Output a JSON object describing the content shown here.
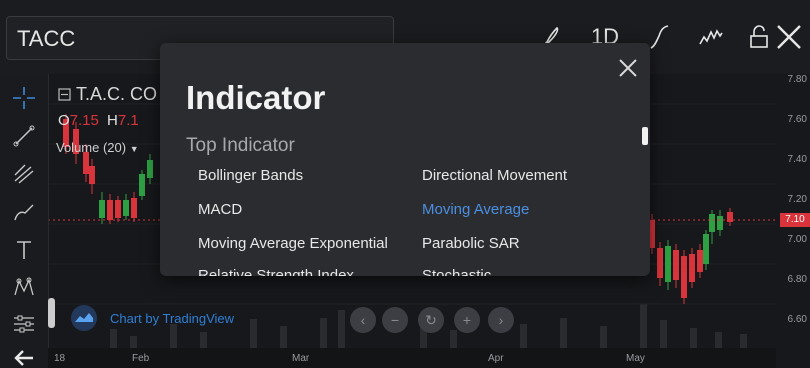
{
  "header": {
    "symbol": "TACC",
    "interval": "1D"
  },
  "legend": {
    "name": "T.A.C. CO",
    "open_label": "O",
    "open_value": "7.15",
    "high_label": "H",
    "high_value": "7.1",
    "volume_label": "Volume (20)"
  },
  "price_axis": [
    "7.80",
    "7.60",
    "7.40",
    "7.20",
    "7.10",
    "7.00",
    "6.80",
    "6.60"
  ],
  "time_axis": [
    "18",
    "Feb",
    "Mar",
    "Apr",
    "May"
  ],
  "watermark": "Chart by TradingView",
  "modal": {
    "title": "Indicator",
    "subtitle": "Top Indicator",
    "items": [
      {
        "label": "Bollinger Bands"
      },
      {
        "label": "Directional Movement"
      },
      {
        "label": "MACD"
      },
      {
        "label": "Moving Average",
        "selected": true
      },
      {
        "label": "Moving Average Exponential"
      },
      {
        "label": "Parabolic SAR"
      },
      {
        "label": "Relative Strength Index"
      },
      {
        "label": "Stochastic"
      }
    ]
  },
  "colors": {
    "up": "#2ea043",
    "down": "#d9343b",
    "accent": "#4c8fe0"
  }
}
